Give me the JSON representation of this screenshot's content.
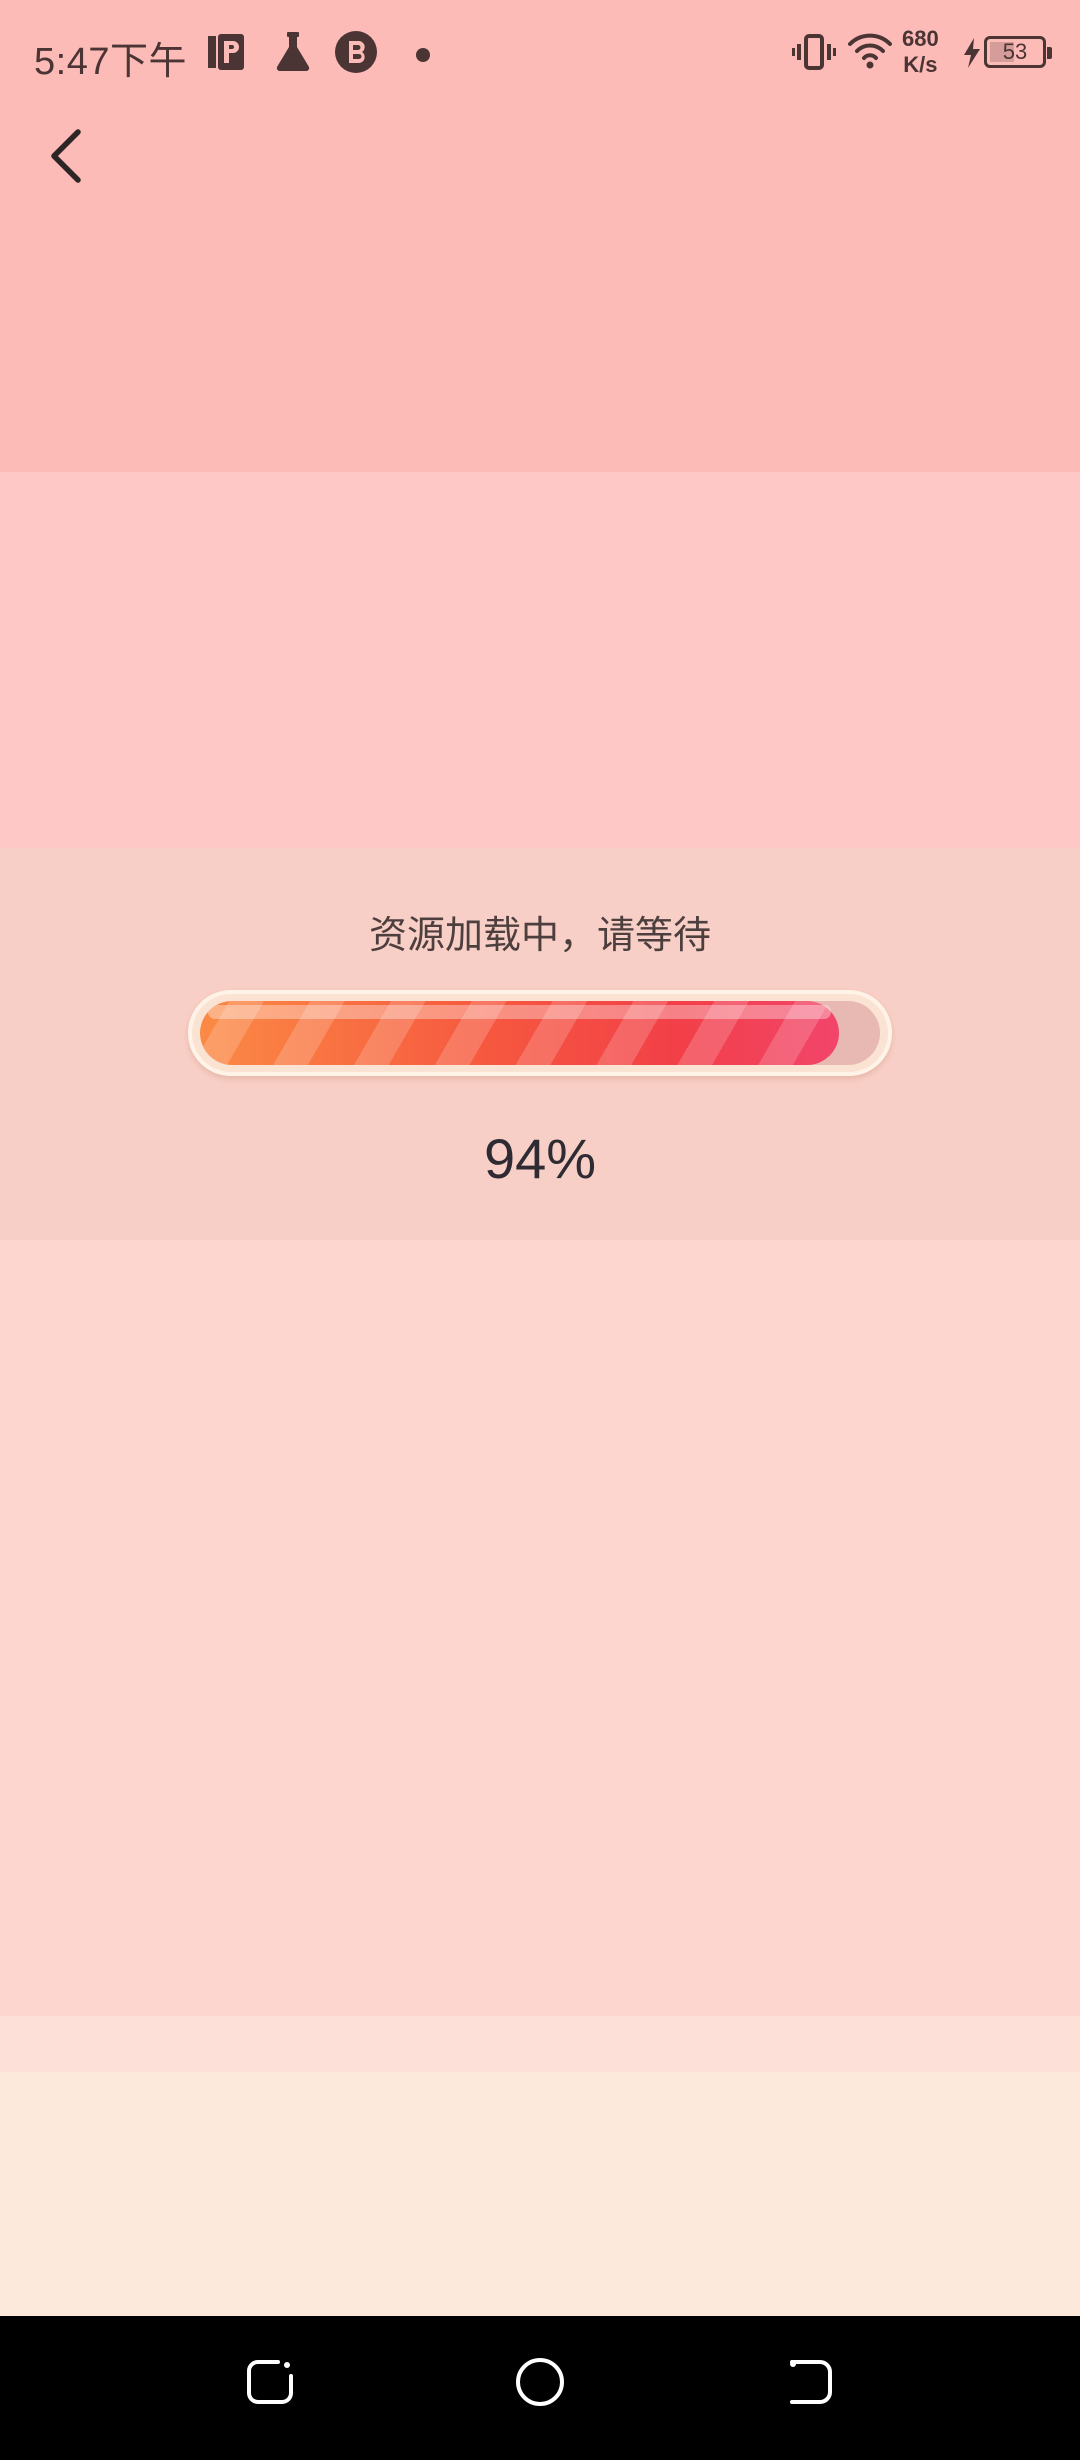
{
  "status_bar": {
    "time": "5:47下午",
    "net_speed_value": "680",
    "net_speed_unit": "K/s",
    "battery_level": "53",
    "icons": [
      "app-p-icon",
      "flask-icon",
      "bilibili-b-icon",
      "notification-dot-icon",
      "vibrate-icon",
      "wifi-icon",
      "charging-bolt-icon",
      "battery-icon"
    ]
  },
  "header": {
    "back_icon": "chevron-left-icon"
  },
  "loading": {
    "title": "资源加载中，请等待",
    "progress_percent": 94,
    "progress_text": "94%"
  },
  "nav_bar": {
    "icons": [
      "recent-apps-icon",
      "home-icon",
      "back-nav-icon"
    ]
  },
  "colors": {
    "top_band": "#fdbbb8",
    "middle_band": "#f8cfc6",
    "progress_start": "#fb8a45",
    "progress_end": "#f2456a",
    "navbar": "#000000"
  }
}
